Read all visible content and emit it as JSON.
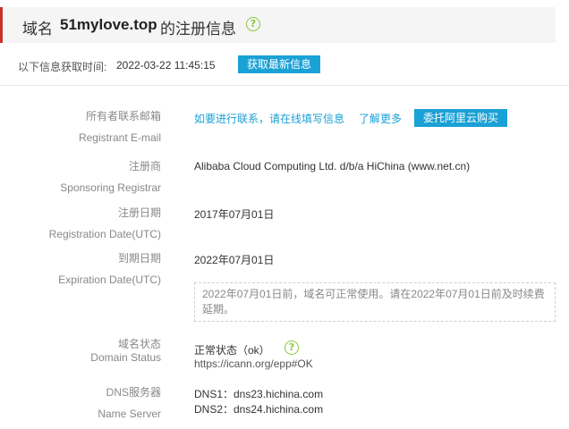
{
  "header": {
    "prefix": "域名",
    "domain": "51mylove.top",
    "suffix": "的注册信息"
  },
  "fetch": {
    "label": "以下信息获取时间:",
    "time": "2022-03-22 11:45:15",
    "button": "获取最新信息"
  },
  "fields": {
    "email": {
      "label_cn": "所有者联系邮箱",
      "label_en": "Registrant E-mail",
      "link1": "如要进行联系，请在线填写信息",
      "link2": "了解更多",
      "button": "委托阿里云购买"
    },
    "registrar": {
      "label_cn": "注册商",
      "label_en": "Sponsoring Registrar",
      "value": "Alibaba Cloud Computing Ltd. d/b/a HiChina (www.net.cn)"
    },
    "reg_date": {
      "label_cn": "注册日期",
      "label_en": "Registration Date(UTC)",
      "value": "2017年07月01日"
    },
    "exp_date": {
      "label_cn": "到期日期",
      "label_en": "Expiration Date(UTC)",
      "value": "2022年07月01日",
      "notice_line1": "2022年07月01日前，域名可正常使用。请在2022年07月01日前及时续费",
      "notice_line2": "延期。"
    },
    "status": {
      "label_cn": "域名状态",
      "label_en": "Domain Status",
      "value": "正常状态（ok）",
      "link": "https://icann.org/epp#OK"
    },
    "dns": {
      "label_cn": "DNS服务器",
      "label_en": "Name Server",
      "ns1": "DNS1：dns23.hichina.com",
      "ns2": "DNS2：dns24.hichina.com"
    }
  },
  "icons": {
    "help": "?"
  },
  "colors": {
    "accent": "#1aa1d6",
    "header_bar": "#c9302c",
    "help_icon": "#8cc63f"
  }
}
